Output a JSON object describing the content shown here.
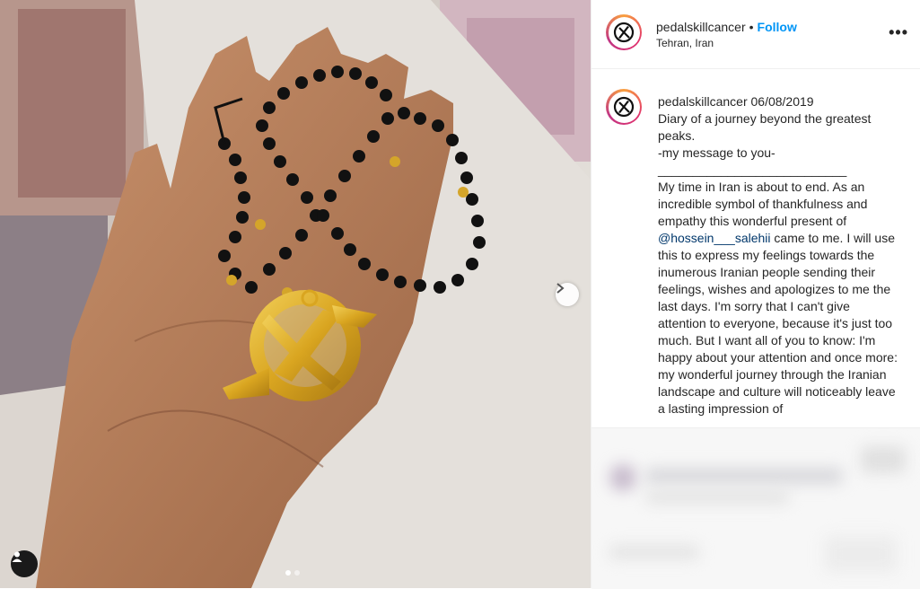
{
  "post": {
    "photo_alt": "Hand holding black bead necklace with golden cycling cancer emblem pendant",
    "carousel": {
      "total": 2,
      "active": 1
    }
  },
  "header": {
    "username": "pedalskillcancer",
    "separator": "•",
    "follow_label": "Follow",
    "location": "Tehran, Iran",
    "more_icon": "more-options-icon",
    "more_label": "•••"
  },
  "caption": {
    "username": "pedalskillcancer",
    "date": "06/08/2019",
    "text_before_mention": "Diary of a journey beyond the greatest peaks.\n-my message to you-\n___________________________\nMy time in Iran is about to end. As an incredible symbol of thankfulness and empathy this wonderful present of ",
    "mention": "@hossein___salehii",
    "text_after_mention": " came to me. I will use this to express my feelings towards the inumerous Iranian people sending their feelings, wishes and apologizes to me the last days. I'm sorry that I can't give attention to everyone, because it's just too much. But I want all of you to know: I'm happy about your attention and once more: my wonderful journey through the Iranian landscape and culture will noticeably leave a lasting impression of"
  },
  "colors": {
    "follow": "#0095f6",
    "mention": "#00376b",
    "text": "#262626",
    "pendant_gold": "#d9a520"
  }
}
